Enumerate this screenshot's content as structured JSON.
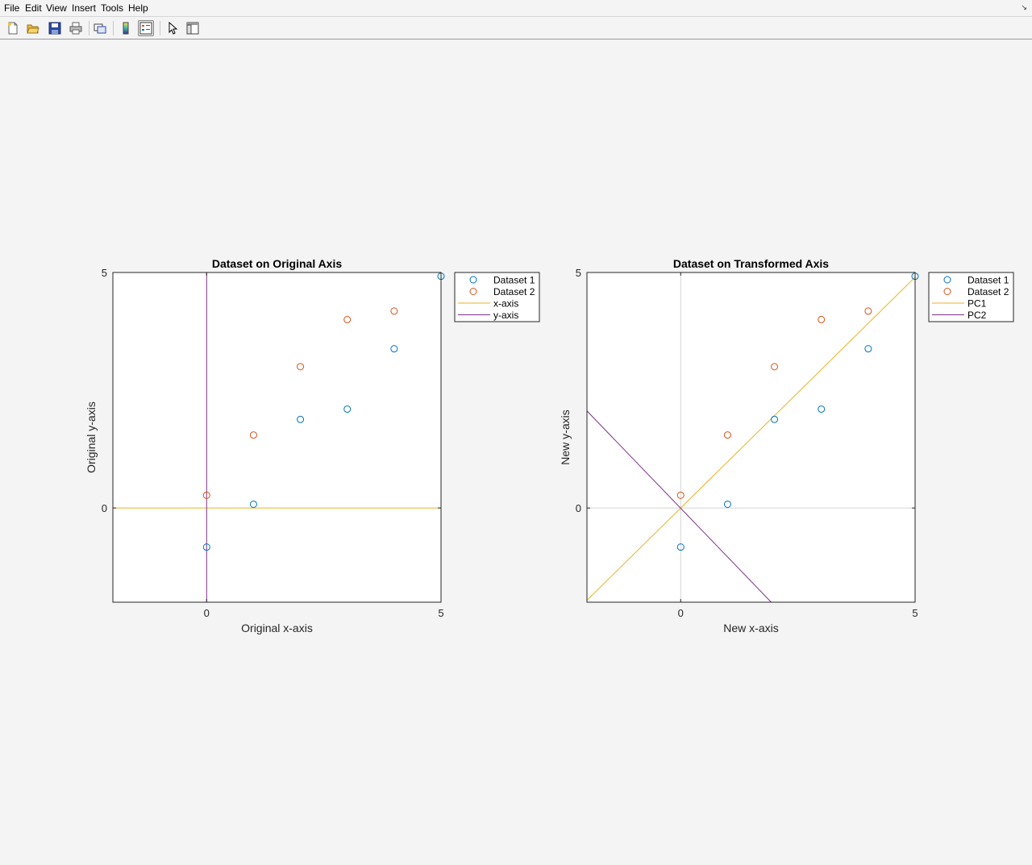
{
  "menubar": {
    "items": [
      "File",
      "Edit",
      "View",
      "Insert",
      "Tools",
      "Help"
    ]
  },
  "toolbar": {
    "buttons": [
      {
        "name": "new-figure-icon"
      },
      {
        "name": "open-file-icon"
      },
      {
        "name": "save-icon"
      },
      {
        "name": "print-icon"
      },
      {
        "name": "link-plot-icon"
      },
      {
        "name": "insert-colorbar-icon"
      },
      {
        "name": "insert-legend-icon"
      },
      {
        "name": "edit-plot-arrow-icon"
      },
      {
        "name": "property-inspector-icon"
      }
    ]
  },
  "colors": {
    "dataset1": "#0072BD",
    "dataset2": "#D95319",
    "line1": "#EDB120",
    "line2": "#7E2F8E"
  },
  "chart_data": [
    {
      "type": "scatter",
      "title": "Dataset on Original Axis",
      "xlabel": "Original x-axis",
      "ylabel": "Original y-axis",
      "xlim": [
        -2,
        5
      ],
      "ylim": [
        -2,
        5
      ],
      "xticks": [
        0,
        5
      ],
      "yticks": [
        0,
        5
      ],
      "series": [
        {
          "name": "Dataset 1",
          "kind": "markers",
          "x": [
            0,
            1,
            2,
            3,
            4,
            5
          ],
          "y": [
            -0.83,
            0.08,
            1.88,
            2.1,
            3.38,
            4.92
          ]
        },
        {
          "name": "Dataset 2",
          "kind": "markers",
          "x": [
            0,
            1,
            2,
            3,
            4
          ],
          "y": [
            0.27,
            1.55,
            3.0,
            4.0,
            4.18
          ]
        },
        {
          "name": "x-axis",
          "kind": "line",
          "x": [
            -2,
            5
          ],
          "y": [
            0,
            0
          ]
        },
        {
          "name": "y-axis",
          "kind": "line",
          "x": [
            0,
            0
          ],
          "y": [
            -2,
            5
          ]
        }
      ],
      "legend": "outside-top-right",
      "grid": false
    },
    {
      "type": "scatter",
      "title": "Dataset on Transformed Axis",
      "xlabel": "New x-axis",
      "ylabel": "New y-axis",
      "xlim": [
        -2,
        5
      ],
      "ylim": [
        -2,
        5
      ],
      "xticks": [
        0,
        5
      ],
      "yticks": [
        0,
        5
      ],
      "origin_crosshair": true,
      "series": [
        {
          "name": "Dataset 1",
          "kind": "markers",
          "x": [
            0,
            1,
            2,
            3,
            4,
            5
          ],
          "y": [
            -0.83,
            0.08,
            1.88,
            2.1,
            3.38,
            4.92
          ]
        },
        {
          "name": "Dataset 2",
          "kind": "markers",
          "x": [
            0,
            1,
            2,
            3,
            4
          ],
          "y": [
            0.27,
            1.55,
            3.0,
            4.0,
            4.18
          ]
        },
        {
          "name": "PC1",
          "kind": "line",
          "x": [
            -2,
            5
          ],
          "y": [
            -1.96,
            4.9
          ]
        },
        {
          "name": "PC2",
          "kind": "line",
          "x": [
            -2,
            1.93
          ],
          "y": [
            2.06,
            -2
          ]
        }
      ],
      "legend": "outside-top-right",
      "grid": false
    }
  ]
}
